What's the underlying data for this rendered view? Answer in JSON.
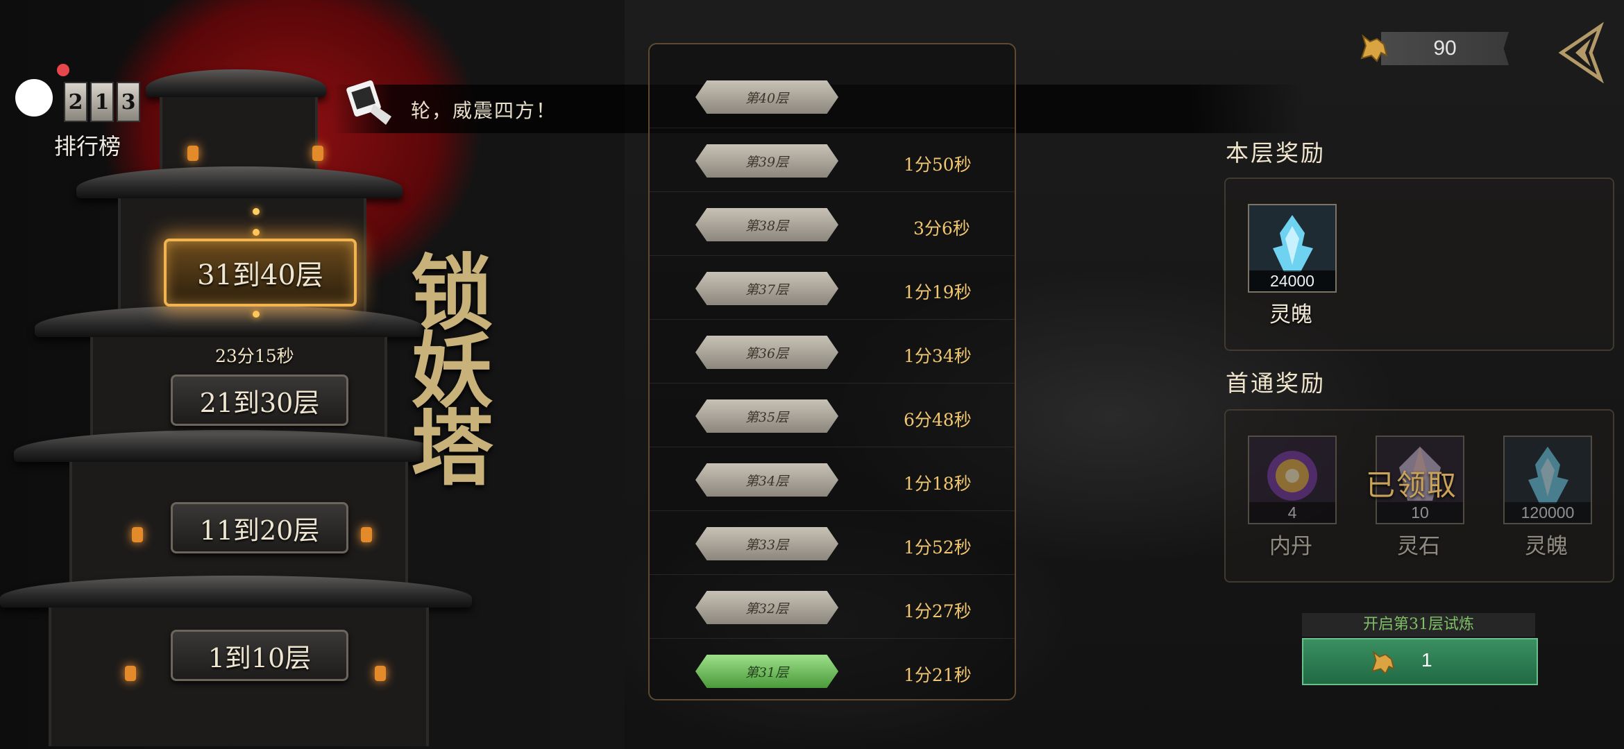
{
  "ranking": {
    "label": "排行榜",
    "badge_digits": [
      "2",
      "1",
      "3"
    ]
  },
  "announcement": {
    "text": "轮，威震四方！"
  },
  "tower": {
    "calligraphy": "锁妖塔",
    "sections": [
      {
        "label": "31到40层",
        "active": true
      },
      {
        "label": "21到30层",
        "active": false
      },
      {
        "label": "11到20层",
        "active": false
      },
      {
        "label": "1到10层",
        "active": false
      }
    ],
    "section_time": "23分15秒"
  },
  "floors": [
    {
      "label": "第40层",
      "time": ""
    },
    {
      "label": "第39层",
      "time": "1分50秒"
    },
    {
      "label": "第38层",
      "time": "3分6秒"
    },
    {
      "label": "第37层",
      "time": "1分19秒"
    },
    {
      "label": "第36层",
      "time": "1分34秒"
    },
    {
      "label": "第35层",
      "time": "6分48秒"
    },
    {
      "label": "第34层",
      "time": "1分18秒"
    },
    {
      "label": "第33层",
      "time": "1分52秒"
    },
    {
      "label": "第32层",
      "time": "1分27秒"
    },
    {
      "label": "第31层",
      "time": "1分21秒",
      "current": true
    }
  ],
  "currency": {
    "value": "90",
    "icon": "golden-beast-icon"
  },
  "rewards": {
    "floor_title": "本层奖励",
    "floor_items": [
      {
        "name": "灵魄",
        "qty": "24000",
        "icon": "blue-soul-crystal-icon"
      }
    ],
    "first_title": "首通奖励",
    "first_items": [
      {
        "name": "内丹",
        "qty": "4",
        "icon": "golden-orb-icon"
      },
      {
        "name": "灵石",
        "qty": "10",
        "icon": "spirit-stone-icon"
      },
      {
        "name": "灵魄",
        "qty": "120000",
        "icon": "blue-soul-crystal-icon"
      }
    ],
    "claimed_label": "已领取"
  },
  "start": {
    "label": "开启第31层试炼",
    "cost": "1"
  },
  "colors": {
    "accent_gold": "#f2b450",
    "green": "#3b8f61",
    "red_moon": "#8c0f12"
  }
}
